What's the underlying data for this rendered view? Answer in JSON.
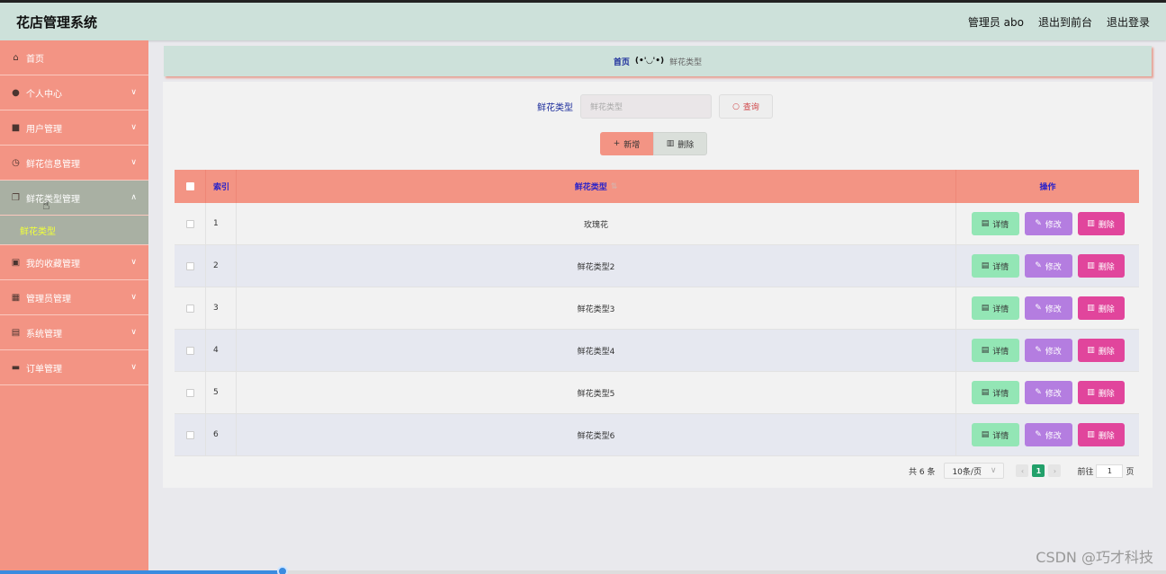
{
  "header": {
    "app_title": "花店管理系统",
    "admin_label": "管理员 abo",
    "front_link": "退出到前台",
    "logout_link": "退出登录"
  },
  "sidebar": {
    "items": [
      {
        "label": "首页",
        "icon": "home-icon"
      },
      {
        "label": "个人中心",
        "icon": "user-icon"
      },
      {
        "label": "用户管理",
        "icon": "briefcase-icon"
      },
      {
        "label": "鲜花信息管理",
        "icon": "clock-icon"
      },
      {
        "label": "鲜花类型管理",
        "icon": "copy-icon"
      },
      {
        "label": "我的收藏管理",
        "icon": "box-icon"
      },
      {
        "label": "管理员管理",
        "icon": "grid-icon"
      },
      {
        "label": "系统管理",
        "icon": "trash-icon"
      },
      {
        "label": "订单管理",
        "icon": "monitor-icon"
      }
    ],
    "sub_item": "鲜花类型"
  },
  "breadcrumb": {
    "home": "首页",
    "separator": "(•'◡'•)",
    "current": "鲜花类型"
  },
  "search": {
    "label": "鲜花类型",
    "placeholder": "鲜花类型",
    "query_button": "查询"
  },
  "actions": {
    "add": "新增",
    "delete": "删除"
  },
  "table": {
    "headers": {
      "index": "索引",
      "name": "鲜花类型",
      "ops": "操作"
    },
    "rows": [
      {
        "index": "1",
        "name": "玫瑰花"
      },
      {
        "index": "2",
        "name": "鲜花类型2"
      },
      {
        "index": "3",
        "name": "鲜花类型3"
      },
      {
        "index": "4",
        "name": "鲜花类型4"
      },
      {
        "index": "5",
        "name": "鲜花类型5"
      },
      {
        "index": "6",
        "name": "鲜花类型6"
      }
    ],
    "op_labels": {
      "detail": "详情",
      "edit": "修改",
      "delete": "删除"
    }
  },
  "pagination": {
    "total": "共 6 条",
    "page_size": "10条/页",
    "current_page": "1",
    "goto_prefix": "前往",
    "goto_value": "1",
    "goto_suffix": "页"
  },
  "watermark": "CSDN @巧才科技",
  "colors": {
    "sidebar": "#f39484",
    "header": "#cde1da",
    "detail_btn": "#93e6b5",
    "edit_btn": "#b47de0",
    "delete_btn": "#e1459c",
    "active_page": "#22a06a"
  }
}
